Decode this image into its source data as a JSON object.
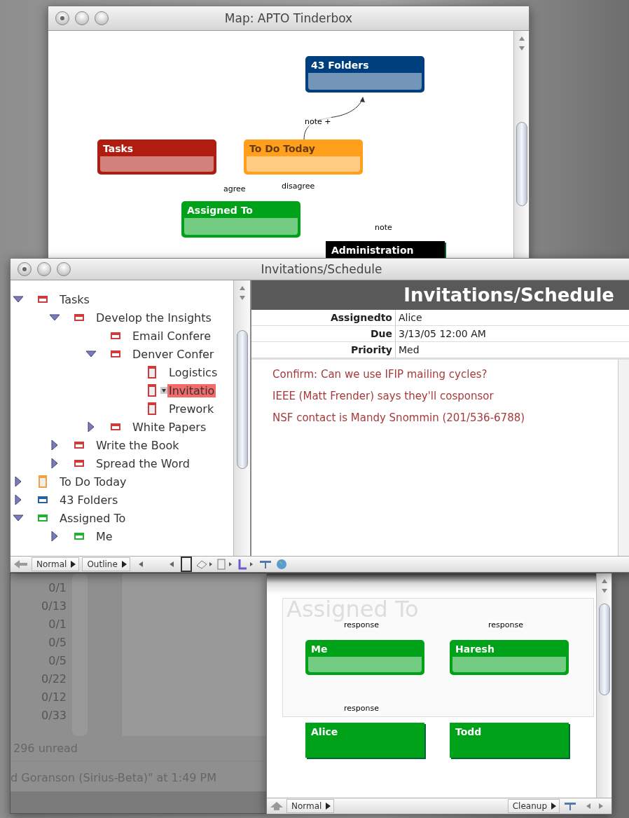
{
  "map_window": {
    "title": "Map: APTO Tinderbox",
    "nodes": [
      {
        "label": "43 Folders",
        "color": "#003f7d",
        "kind": "split"
      },
      {
        "label": "Tasks",
        "color": "#b01c10",
        "kind": "split"
      },
      {
        "label": "To Do Today",
        "color": "#ff9f1c",
        "kind": "split"
      },
      {
        "label": "Assigned To",
        "color": "#00a21a",
        "kind": "split"
      },
      {
        "label": "Administration",
        "color": "#000000",
        "kind": "solid"
      }
    ],
    "links": [
      {
        "label": "note +"
      },
      {
        "label": "agree"
      },
      {
        "label": "disagree"
      },
      {
        "label": "note"
      }
    ]
  },
  "mail_window": {
    "counts": [
      "0/1",
      "0/13",
      "0/1",
      "0/5",
      "0/5",
      "0/22",
      "0/12",
      "0/33"
    ],
    "unread": "296 unread",
    "status": "d Goranson (Sirius-Beta)\" at 1:49 PM"
  },
  "assign_map_window": {
    "region": "Assigned To",
    "nodes": [
      {
        "label": "Me",
        "color": "#00a21a",
        "kind": "split"
      },
      {
        "label": "Haresh",
        "color": "#00a21a",
        "kind": "split"
      },
      {
        "label": "Alice",
        "color": "#00a21a",
        "kind": "solid"
      },
      {
        "label": "Todd",
        "color": "#00a21a",
        "kind": "solid"
      }
    ],
    "links": [
      {
        "label": "response"
      },
      {
        "label": "response"
      },
      {
        "label": "response"
      }
    ],
    "toolbar": {
      "view": "Normal",
      "action": "Cleanup"
    }
  },
  "main_window": {
    "title": "Invitations/Schedule",
    "outline": [
      {
        "label": "Tasks",
        "kind": "note",
        "color": "#d03a3a",
        "expanded": true,
        "selected": false,
        "children": [
          {
            "label": "Develop the Insights",
            "kind": "note",
            "color": "#d03a3a",
            "expanded": true,
            "selected": false,
            "children": [
              {
                "label": "Email Confere",
                "kind": "note",
                "color": "#d03a3a",
                "selected": false
              },
              {
                "label": "Denver Confer",
                "kind": "note",
                "color": "#d03a3a",
                "expanded": true,
                "selected": false,
                "children": [
                  {
                    "label": "Logistics",
                    "kind": "page",
                    "color": "#d03a3a",
                    "selected": false
                  },
                  {
                    "label": "Invitatio",
                    "kind": "page",
                    "color": "#d03a3a",
                    "selected": true
                  },
                  {
                    "label": "Prework",
                    "kind": "page",
                    "color": "#d03a3a",
                    "selected": false
                  }
                ]
              },
              {
                "label": "White Papers",
                "kind": "note",
                "color": "#d03a3a",
                "expanded": false,
                "selected": false
              }
            ]
          },
          {
            "label": "Write the Book",
            "kind": "note",
            "color": "#d03a3a",
            "expanded": false,
            "selected": false
          },
          {
            "label": "Spread the Word",
            "kind": "note",
            "color": "#d03a3a",
            "expanded": false,
            "selected": false
          }
        ]
      },
      {
        "label": "To Do Today",
        "kind": "page",
        "color": "#f5a040",
        "expanded": false,
        "selected": false
      },
      {
        "label": "43 Folders",
        "kind": "note",
        "color": "#2a5fa0",
        "expanded": false,
        "selected": false
      },
      {
        "label": "Assigned To",
        "kind": "note",
        "color": "#22b032",
        "expanded": true,
        "selected": false,
        "children": [
          {
            "label": "Me",
            "kind": "note",
            "color": "#22b032",
            "expanded": false,
            "selected": false
          }
        ]
      }
    ],
    "outline_toolbar": {
      "view": "Normal",
      "mode": "Outline"
    },
    "note": {
      "title": "Invitations/Schedule",
      "attributes": [
        {
          "name": "Assignedto",
          "value": "Alice"
        },
        {
          "name": "Due",
          "value": "3/13/05 12:00 AM"
        },
        {
          "name": "Priority",
          "value": "Med"
        }
      ],
      "text": [
        "Confirm: Can we use IFIP mailing cycles?",
        "IEEE (Matt Frender) says they'll cosponsor",
        "NSF contact is Mandy Snommin (201/536-6788)"
      ]
    }
  }
}
